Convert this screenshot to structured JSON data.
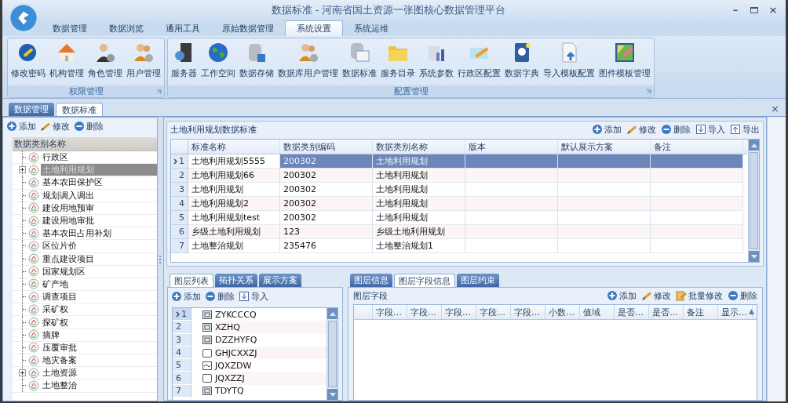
{
  "window": {
    "title": "数据标准 - 河南省国土资源一张图核心数据管理平台",
    "controls": [
      {
        "kind": "minimize",
        "symbol": "–"
      },
      {
        "kind": "maximize"
      },
      {
        "kind": "close",
        "symbol": "×"
      }
    ]
  },
  "ribbon_tabs": [
    {
      "label": "数据管理",
      "selected": false
    },
    {
      "label": "数据浏览",
      "selected": false
    },
    {
      "label": "通用工具",
      "selected": false
    },
    {
      "label": "原始数据管理",
      "selected": false
    },
    {
      "label": "系统设置",
      "selected": true
    },
    {
      "label": "系统运维",
      "selected": false
    }
  ],
  "ribbon_groups": [
    {
      "title": "权限管理",
      "buttons": [
        "修改密码",
        "机构管理",
        "角色管理",
        "用户管理"
      ]
    },
    {
      "title": "配置管理",
      "buttons": [
        "服务器",
        "工作空间",
        "数据存储",
        "数据库用户管理",
        "数据标准",
        "服务目录",
        "系统参数",
        "行政区配置",
        "数据字典",
        "导入模板配置",
        "图件模板管理"
      ]
    }
  ],
  "document_tabs": [
    {
      "label": "数据管理",
      "selected": false
    },
    {
      "label": "数据标准",
      "selected": true
    }
  ],
  "document_close": "×",
  "left_panel": {
    "toolbar": [
      {
        "kind": "add",
        "label": "添加"
      },
      {
        "kind": "edit",
        "label": "修改"
      },
      {
        "kind": "delete",
        "label": "删除"
      }
    ],
    "tree_header": "数据类别名称",
    "tree": [
      {
        "label": "行政区",
        "kind": "leaf",
        "selected": false
      },
      {
        "label": "土地利用规划",
        "kind": "group",
        "selected": true
      },
      {
        "label": "基本农田保护区",
        "kind": "leaf",
        "selected": false
      },
      {
        "label": "规划调入调出",
        "kind": "leaf",
        "selected": false
      },
      {
        "label": "建设用地预审",
        "kind": "leaf",
        "selected": false
      },
      {
        "label": "建设用地审批",
        "kind": "leaf",
        "selected": false
      },
      {
        "label": "基本农田占用补划",
        "kind": "leaf",
        "selected": false
      },
      {
        "label": "区位片价",
        "kind": "leaf",
        "selected": false
      },
      {
        "label": "重点建设项目",
        "kind": "leaf",
        "selected": false
      },
      {
        "label": "国家规划区",
        "kind": "leaf",
        "selected": false
      },
      {
        "label": "矿产地",
        "kind": "leaf",
        "selected": false
      },
      {
        "label": "调查项目",
        "kind": "leaf",
        "selected": false
      },
      {
        "label": "采矿权",
        "kind": "leaf",
        "selected": false
      },
      {
        "label": "探矿权",
        "kind": "leaf",
        "selected": false
      },
      {
        "label": "摘牌",
        "kind": "leaf",
        "selected": false
      },
      {
        "label": "压覆审批",
        "kind": "leaf",
        "selected": false
      },
      {
        "label": "地灾备案",
        "kind": "leaf",
        "selected": false
      },
      {
        "label": "土地资源",
        "kind": "group",
        "selected": false
      },
      {
        "label": "土地整治",
        "kind": "leaf",
        "selected": false
      }
    ]
  },
  "standards": {
    "title": "土地利用规划数据标准",
    "toolbar": [
      {
        "kind": "add",
        "label": "添加"
      },
      {
        "kind": "edit",
        "label": "修改"
      },
      {
        "kind": "delete",
        "label": "删除"
      },
      {
        "kind": "import",
        "label": "导入"
      },
      {
        "kind": "export",
        "label": "导出"
      }
    ],
    "columns": [
      "标准名称",
      "数据类别编码",
      "数据类别名称",
      "版本",
      "默认展示方案",
      "备注"
    ],
    "rows": [
      {
        "index": "1",
        "selected": true,
        "cells": [
          "土地利用规划5555",
          "200302",
          "土地利用规划"
        ]
      },
      {
        "index": "2",
        "selected": false,
        "cells": [
          "土地利用规划66",
          "200302",
          "土地利用规划"
        ]
      },
      {
        "index": "3",
        "selected": false,
        "cells": [
          "土地利用规划",
          "200302",
          "土地利用规划"
        ]
      },
      {
        "index": "4",
        "selected": false,
        "cells": [
          "土地利用规划2",
          "200302",
          "土地利用规划"
        ]
      },
      {
        "index": "5",
        "selected": false,
        "cells": [
          "土地利用规划test",
          "200302",
          "土地利用规划"
        ]
      },
      {
        "index": "6",
        "selected": false,
        "cells": [
          "乡级土地利用规划",
          "123",
          "乡级土地利用规划"
        ]
      },
      {
        "index": "7",
        "selected": false,
        "cells": [
          "土地整治规划",
          "235476",
          "土地整治规划1"
        ]
      }
    ]
  },
  "layers": {
    "tabs": [
      {
        "label": "图层列表",
        "selected": true
      },
      {
        "label": "拓扑关系",
        "selected": false
      },
      {
        "label": "展示方案",
        "selected": false
      }
    ],
    "toolbar": [
      {
        "kind": "add",
        "label": "添加"
      },
      {
        "kind": "delete",
        "label": "删除"
      },
      {
        "kind": "import",
        "label": "导入"
      }
    ],
    "rows": [
      {
        "index": "1",
        "selected": true,
        "kind": "polygon",
        "name": "ZYKCCCQ"
      },
      {
        "index": "2",
        "selected": false,
        "kind": "polygon",
        "name": "XZHQ"
      },
      {
        "index": "3",
        "selected": false,
        "kind": "polygon",
        "name": "DZZHYFQ"
      },
      {
        "index": "4",
        "selected": false,
        "kind": "empty",
        "name": "GHJCXXZJ"
      },
      {
        "index": "5",
        "selected": false,
        "kind": "line",
        "name": "JQXZDW"
      },
      {
        "index": "6",
        "selected": false,
        "kind": "empty",
        "name": "JQXZZJ"
      },
      {
        "index": "7",
        "selected": false,
        "kind": "polygon",
        "name": "TDYTQ"
      }
    ]
  },
  "fields": {
    "tabs": [
      {
        "label": "图层信息",
        "selected": false
      },
      {
        "label": "图层字段信息",
        "selected": true
      },
      {
        "label": "图层约束",
        "selected": false
      }
    ],
    "title": "图层字段",
    "toolbar": [
      {
        "kind": "add",
        "label": "添加"
      },
      {
        "kind": "edit",
        "label": "修改"
      },
      {
        "kind": "batch-edit",
        "label": "批量修改"
      },
      {
        "kind": "delete",
        "label": "删除"
      }
    ],
    "columns": [
      "字段…",
      "字段…",
      "字段…",
      "字段…",
      "字段…",
      "小数…",
      "值域",
      "是否…",
      "是否…",
      "备注",
      "显示…"
    ],
    "sort_symbol": "▲"
  }
}
